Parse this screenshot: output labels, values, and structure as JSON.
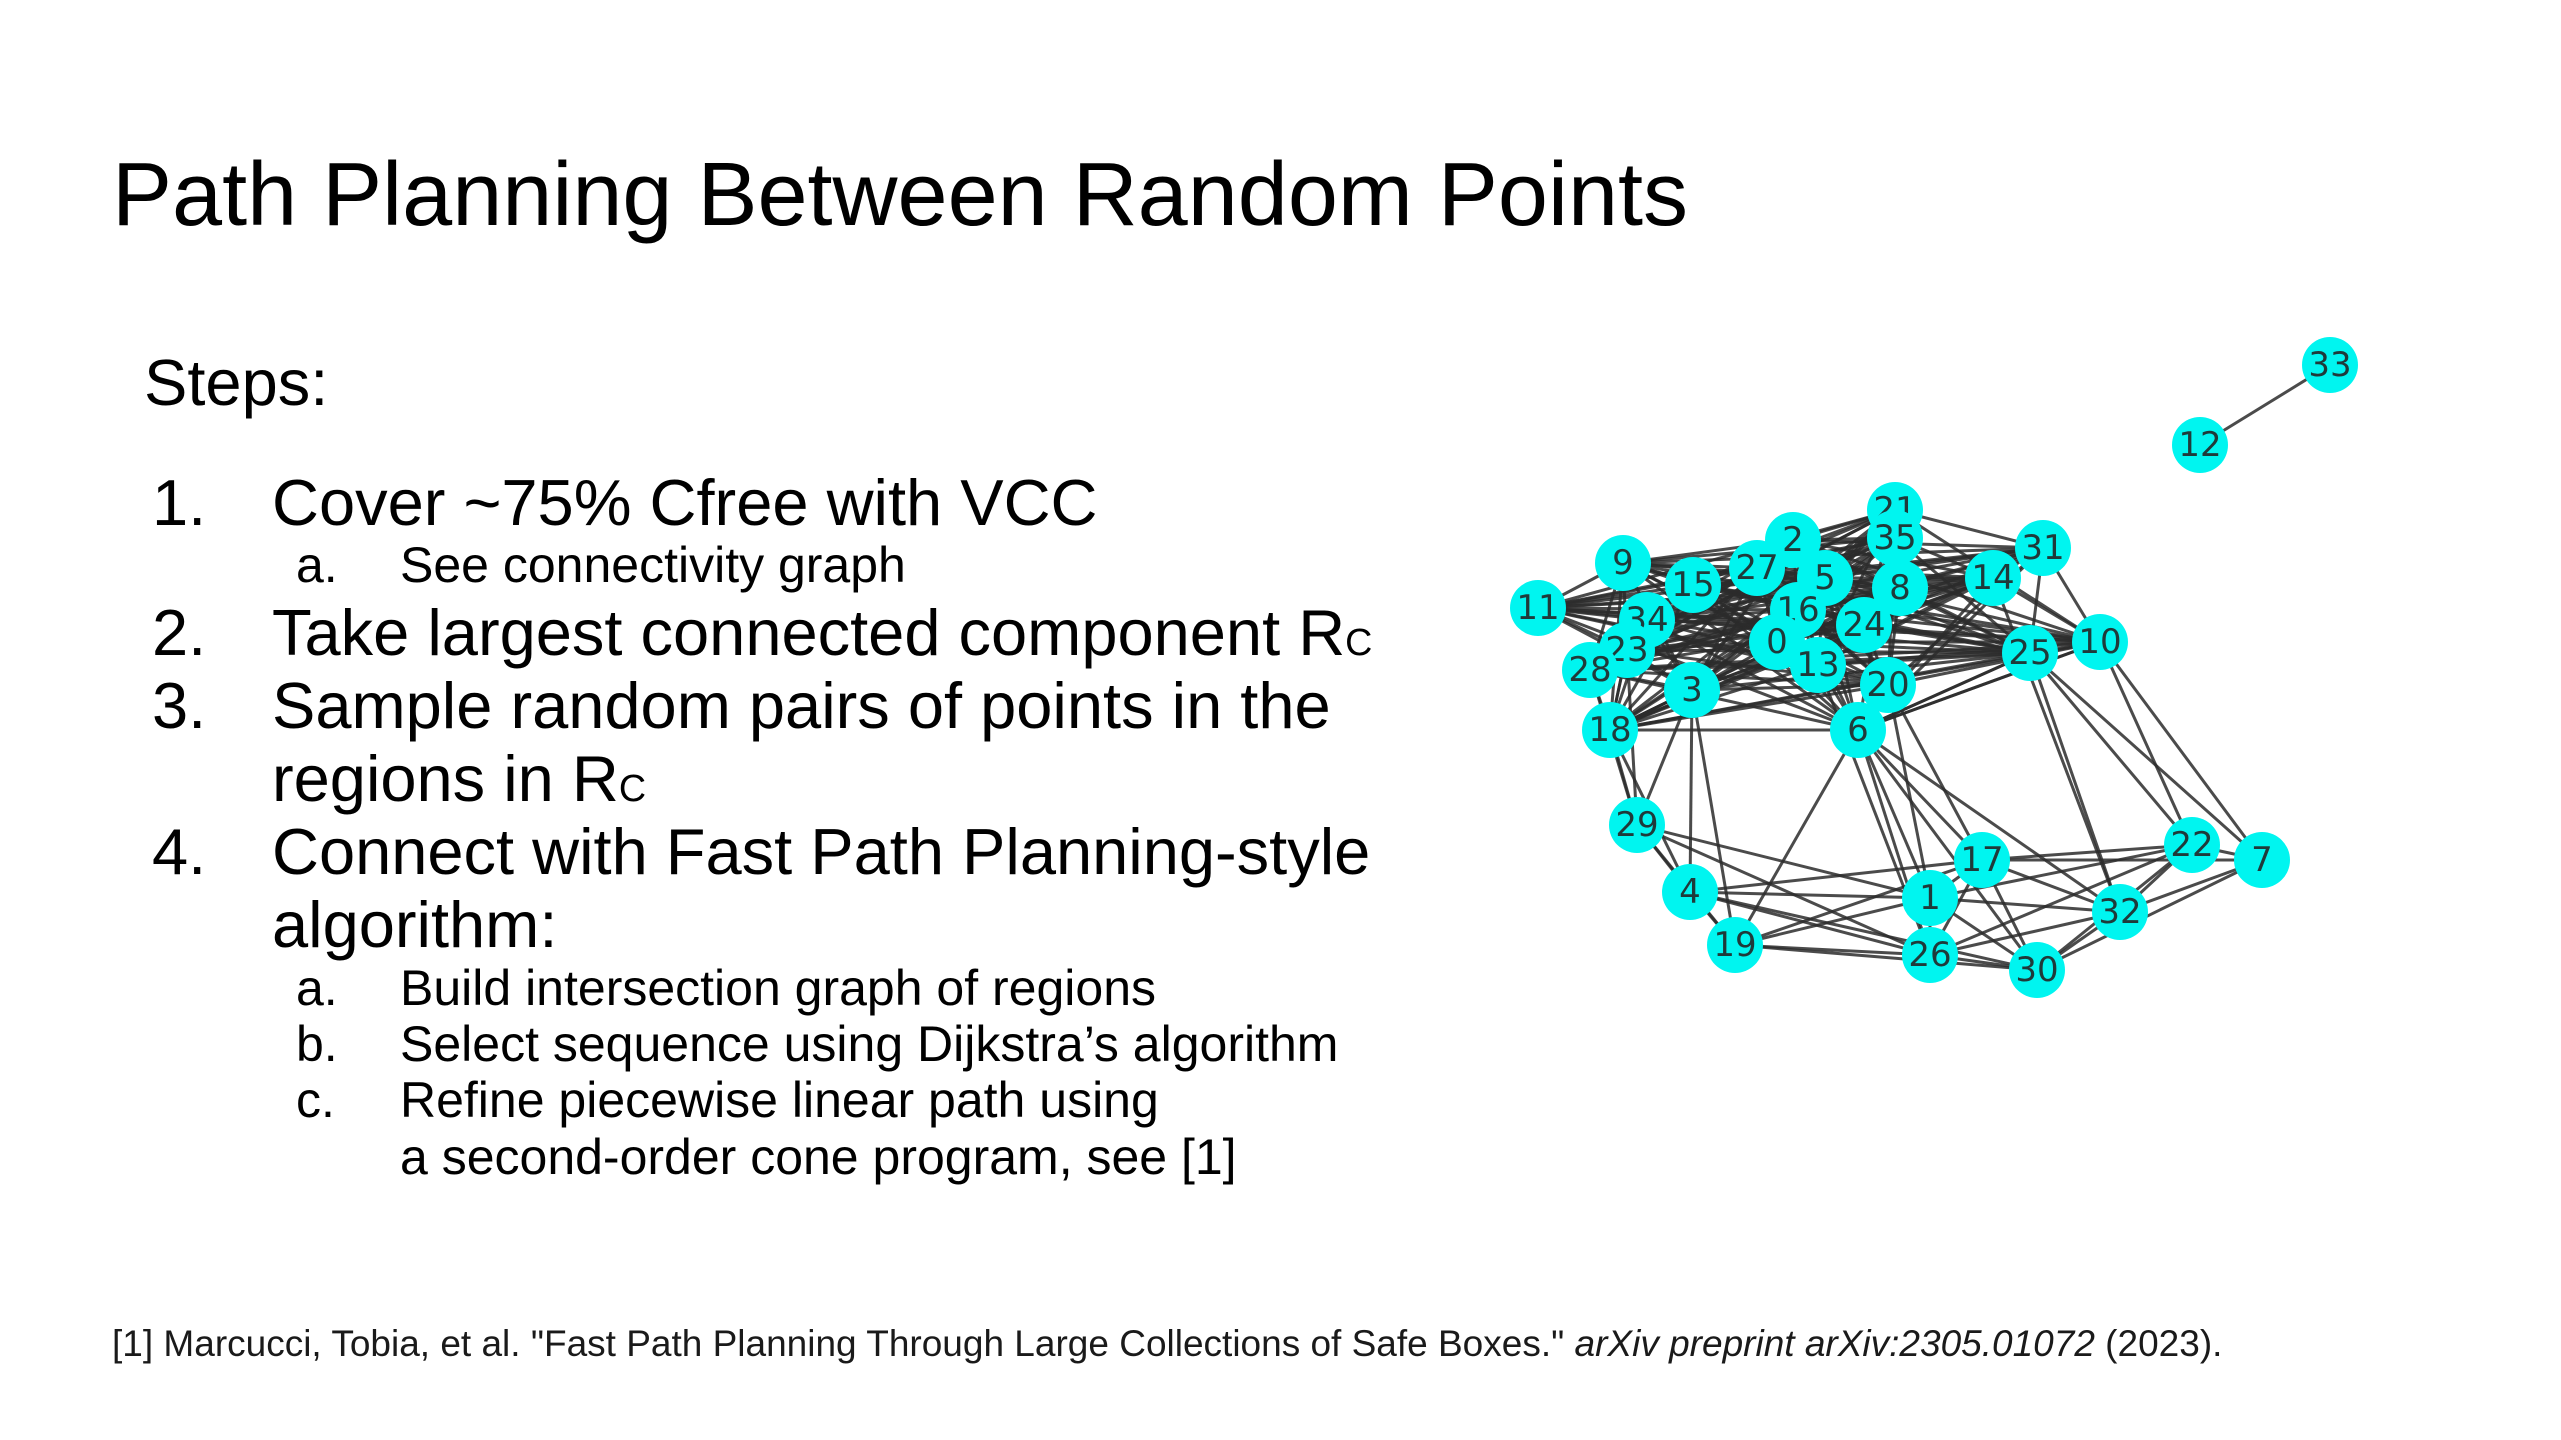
{
  "title": "Path Planning Between Random Points",
  "steps_heading": "Steps:",
  "steps": [
    {
      "num": "1.",
      "text": "Cover ~75% Cfree with VCC"
    },
    {
      "num": "a.",
      "text": "See connectivity graph"
    },
    {
      "num": "2.",
      "text": "Take largest connected component R",
      "sub": "C"
    },
    {
      "num": "3.",
      "text": "Sample random pairs of points in the"
    },
    {
      "num": "",
      "text": "regions in R",
      "sub": "C"
    },
    {
      "num": "4.",
      "text": "Connect  with Fast Path Planning-style"
    },
    {
      "num": "",
      "text": "algorithm:"
    },
    {
      "num": "a.",
      "text": "Build intersection graph of regions"
    },
    {
      "num": "b.",
      "text": "Select sequence using Dijkstra’s algorithm"
    },
    {
      "num": "c.",
      "text": "Refine piecewise linear path using"
    },
    {
      "num": "",
      "text": "a second-order cone program, see [1]"
    }
  ],
  "reference": {
    "prefix": "[1] Marcucci, Tobia, et al. \"Fast Path Planning Through Large Collections of Safe Boxes.\" ",
    "journal": "arXiv preprint arXiv:2305.01072",
    "suffix": " (2023)."
  },
  "graph": {
    "node_color": "#00f5f0",
    "edge_color": "#2b2b2b",
    "nodes": [
      "33",
      "12",
      "21",
      "35",
      "2",
      "31",
      "9",
      "27",
      "5",
      "15",
      "14",
      "8",
      "11",
      "16",
      "34",
      "24",
      "0",
      "10",
      "25",
      "23",
      "28",
      "13",
      "20",
      "3",
      "18",
      "6",
      "29",
      "22",
      "17",
      "7",
      "1",
      "4",
      "32",
      "19",
      "26",
      "30"
    ],
    "edges": [
      [
        "12",
        "33"
      ]
    ]
  }
}
